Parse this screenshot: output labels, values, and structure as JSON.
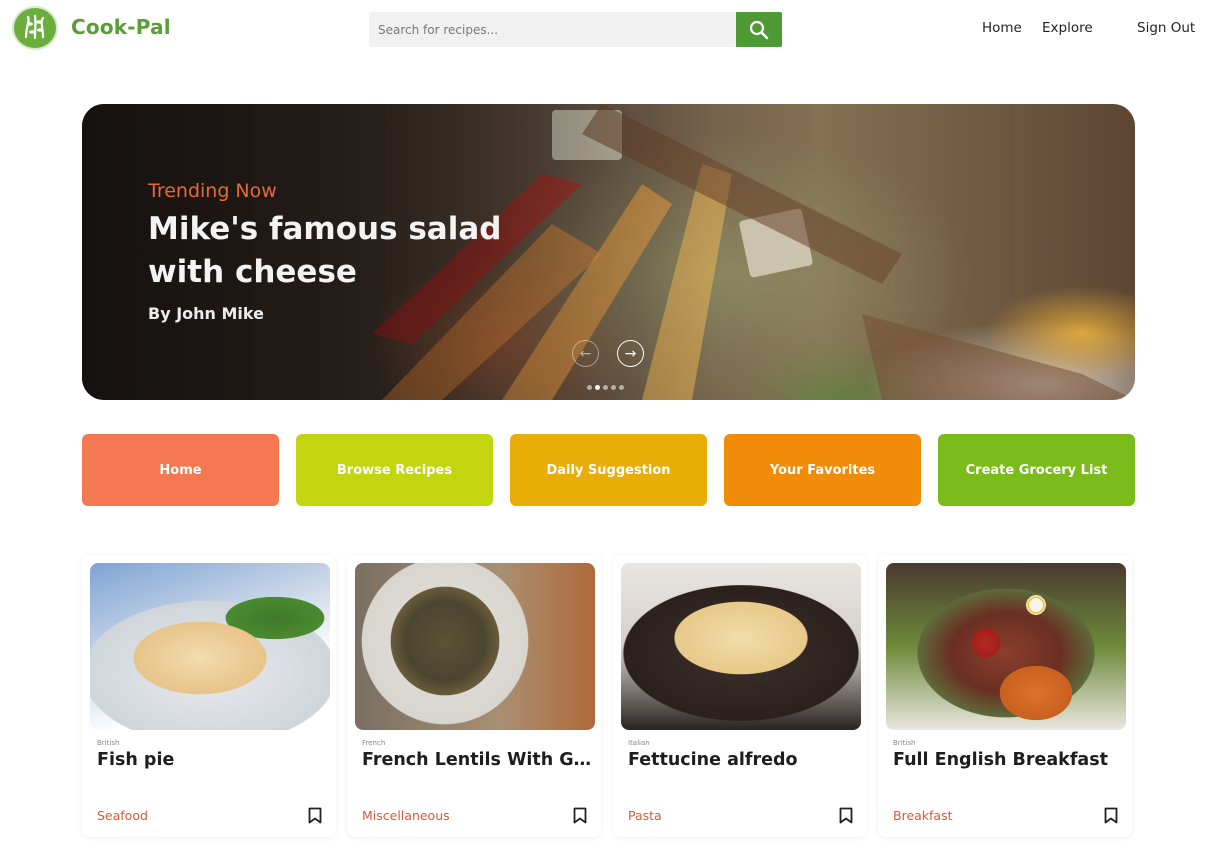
{
  "header": {
    "brand": "Cook-Pal",
    "search_placeholder": "Search for recipes...",
    "nav": {
      "home": "Home",
      "explore": "Explore",
      "sign_out": "Sign Out"
    }
  },
  "hero": {
    "kicker": "Trending Now",
    "title": "Mike's famous salad with cheese",
    "author": "By John Mike",
    "slide_count": 5,
    "active_slide": 1
  },
  "categories": [
    {
      "label": "Home",
      "color": "#f47851"
    },
    {
      "label": "Browse Recipes",
      "color": "#c2d50e"
    },
    {
      "label": "Daily Suggestion",
      "color": "#e9ad07"
    },
    {
      "label": "Your Favorites",
      "color": "#f08c07"
    },
    {
      "label": "Create Grocery List",
      "color": "#7bbb1a"
    }
  ],
  "recipes": [
    {
      "cuisine": "British",
      "title": "Fish pie",
      "tag": "Seafood"
    },
    {
      "cuisine": "French",
      "title": "French Lentils With Garlic and Thyme",
      "tag": "Miscellaneous"
    },
    {
      "cuisine": "Italian",
      "title": "Fettucine alfredo",
      "tag": "Pasta"
    },
    {
      "cuisine": "British",
      "title": "Full English Breakfast",
      "tag": "Breakfast"
    }
  ],
  "colors": {
    "brand_green": "#5a9e35",
    "search_button": "#4e9a34",
    "accent_orange": "#e56a3a",
    "tag_color": "#d85a3a"
  }
}
